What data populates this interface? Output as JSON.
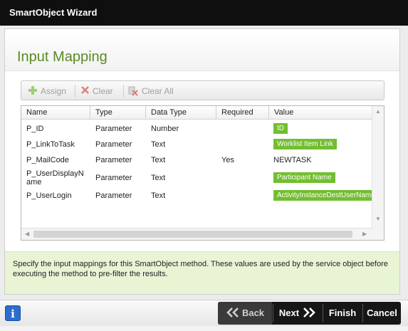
{
  "window": {
    "title": "SmartObject Wizard"
  },
  "page": {
    "title": "Input Mapping"
  },
  "toolbar": {
    "assign": "Assign",
    "clear": "Clear",
    "clear_all": "Clear All"
  },
  "grid": {
    "columns": [
      "Name",
      "Type",
      "Data Type",
      "Required",
      "Value"
    ],
    "rows": [
      {
        "name": "P_ID",
        "type": "Parameter",
        "data_type": "Number",
        "required": "",
        "value": "ID",
        "value_is_tag": true
      },
      {
        "name": "P_LinkToTask",
        "type": "Parameter",
        "data_type": "Text",
        "required": "",
        "value": "Worklist Item Link",
        "value_is_tag": true
      },
      {
        "name": "P_MailCode",
        "type": "Parameter",
        "data_type": "Text",
        "required": "Yes",
        "value": "NEWTASK",
        "value_is_tag": false
      },
      {
        "name_line1": "P_UserDisplayN",
        "name_line2": "ame",
        "type": "Parameter",
        "data_type": "Text",
        "required": "",
        "value": "Participant Name",
        "value_is_tag": true
      },
      {
        "name": "P_UserLogin",
        "type": "Parameter",
        "data_type": "Text",
        "required": "",
        "value": "ActivityInstanceDestUserName",
        "value_is_tag": true
      }
    ]
  },
  "help": {
    "text": "Specify the input mappings for this SmartObject method. These values are used by the service object before executing the method to pre-filter the results."
  },
  "footer": {
    "back": "Back",
    "next": "Next",
    "finish": "Finish",
    "cancel": "Cancel",
    "info": "i"
  },
  "colors": {
    "accent_green": "#72be30",
    "title_green": "#5a8a23",
    "help_bg": "#e8f4d4",
    "titlebar": "#0f0f0f",
    "info_blue": "#2a6fd0"
  },
  "icons": {
    "assign": "plus-icon",
    "clear": "x-icon",
    "clear_all": "clear-all-icon",
    "back": "double-chevron-left-icon",
    "next": "double-chevron-right-icon"
  }
}
